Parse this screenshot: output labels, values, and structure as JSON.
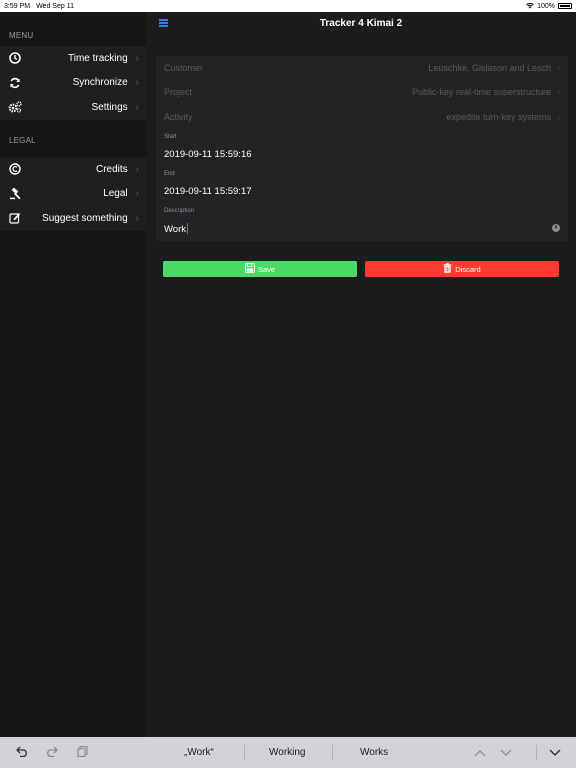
{
  "status": {
    "time": "3:59 PM",
    "date": "Wed Sep 11",
    "battery": "100%"
  },
  "sidebar": {
    "menu_header": "MENU",
    "menu_items": [
      {
        "label": "Time tracking",
        "icon": "clock-icon"
      },
      {
        "label": "Synchronize",
        "icon": "sync-icon"
      },
      {
        "label": "Settings",
        "icon": "gears-icon"
      }
    ],
    "legal_header": "LEGAL",
    "legal_items": [
      {
        "label": "Credits",
        "icon": "copyright-icon"
      },
      {
        "label": "Legal",
        "icon": "gavel-icon"
      },
      {
        "label": "Suggest something",
        "icon": "edit-icon"
      }
    ]
  },
  "nav": {
    "title": "Tracker 4 Kimai 2"
  },
  "form": {
    "customer": {
      "label": "Customer",
      "value": "Leuschke, Gislason and Lesch"
    },
    "project": {
      "label": "Project",
      "value": "Public-key real-time superstructure"
    },
    "activity": {
      "label": "Activity",
      "value": "expedite turn-key systems"
    },
    "start": {
      "label": "Start",
      "value": "2019-09-11 15:59:16"
    },
    "end": {
      "label": "End",
      "value": "2019-09-11 15:59:17"
    },
    "description": {
      "label": "Description",
      "value": "Work"
    }
  },
  "actions": {
    "save": "Save",
    "discard": "Discard"
  },
  "colors": {
    "save": "#4cd964",
    "discard": "#ff3b30",
    "accent": "#2f7bf5"
  },
  "keyboard": {
    "suggestions": [
      "„Work“",
      "Working",
      "Works"
    ]
  }
}
